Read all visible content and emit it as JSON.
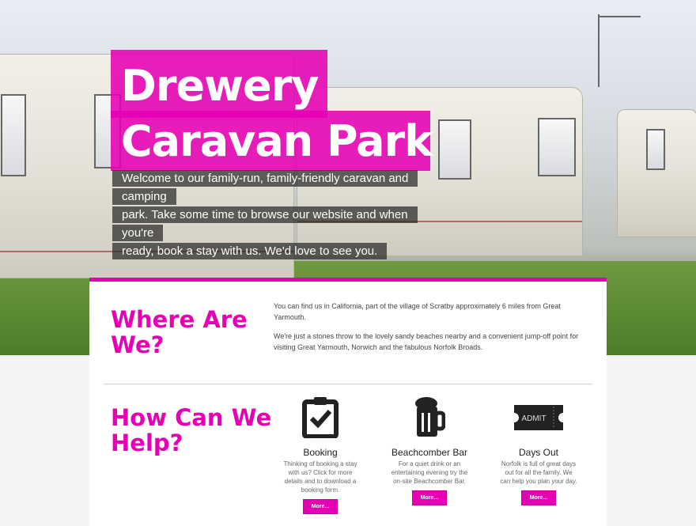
{
  "hero": {
    "title_line1": "Drewery",
    "title_line2": "Caravan Park",
    "intro_line1": "Welcome to our family-run, family-friendly caravan and camping",
    "intro_line2": "park. Take some time to browse our website and when you're",
    "intro_line3": "ready, book a stay with us. We'd love to see you."
  },
  "where": {
    "heading_line1": "Where Are",
    "heading_line2": "We?",
    "p1": "You can find us in California, part of the village of Scratby approximately 6 miles from Great Yarmouth.",
    "p2": "We're just a stones throw to the lovely sandy beaches nearby and a convenient jump-off point for visiting Great Yarmouth, Norwich and the fabulous Norfolk Broads."
  },
  "help": {
    "heading_line1": "How Can We",
    "heading_line2": "Help?",
    "services": [
      {
        "icon": "clipboard-check-icon",
        "title": "Booking",
        "text": "Thinking of booking a stay with us? Click for more details and to download a booking form.",
        "button": "More..."
      },
      {
        "icon": "beer-mug-icon",
        "title": "Beachcomber Bar",
        "text": "For a quiet drink or an entertaining evening try the on-site Beachcomber Bar.",
        "button": "More..."
      },
      {
        "icon": "admit-ticket-icon",
        "title": "Days Out",
        "text": "Norfolk is full of great days out for all the family. We can help you plan your day.",
        "button": "More...",
        "ticket_text": "ADMIT"
      }
    ]
  },
  "colors": {
    "accent": "#e600b4"
  }
}
